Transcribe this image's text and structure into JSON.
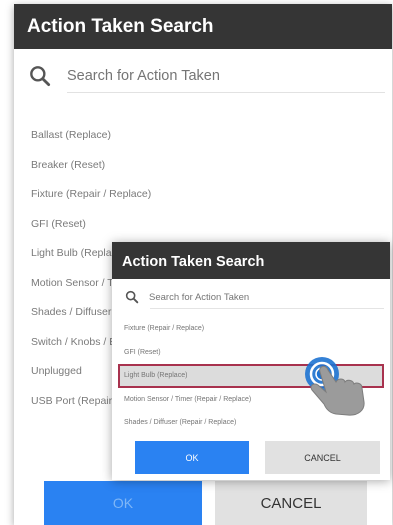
{
  "main_dialog": {
    "title": "Action Taken Search",
    "search": {
      "placeholder": "Search for Action Taken"
    },
    "items": [
      "Ballast (Replace)",
      "Breaker (Reset)",
      "Fixture (Repair / Replace)",
      "GFI (Reset)",
      "Light Bulb (Replace)",
      "Motion Sensor / Timer (Repair / Replace)",
      "Shades / Diffuser (Repair / Replace)",
      "Switch / Knobs / Buttons (Repair / Replace)",
      "Unplugged",
      "USB Port (Repair / Replace)"
    ],
    "ok_label": "OK",
    "cancel_label": "CANCEL"
  },
  "inset_dialog": {
    "title": "Action Taken Search",
    "search": {
      "placeholder": "Search for Action Taken"
    },
    "items": [
      "Fixture (Repair / Replace)",
      "GFI (Reset)",
      "Light Bulb (Replace)",
      "Motion Sensor / Timer (Repair / Replace)",
      "Shades / Diffuser (Repair / Replace)"
    ],
    "selected_item": "Light Bulb (Replace)",
    "ok_label": "OK",
    "cancel_label": "CANCEL"
  },
  "colors": {
    "header": "#353535",
    "ok_blue": "#2a82f2",
    "cancel_gray": "#e1e1e1",
    "selection_border": "#a8324e",
    "tap_indicator": "#1e73d2"
  },
  "icons": {
    "search": "magnifier-icon",
    "pointer": "hand-tap-icon"
  }
}
